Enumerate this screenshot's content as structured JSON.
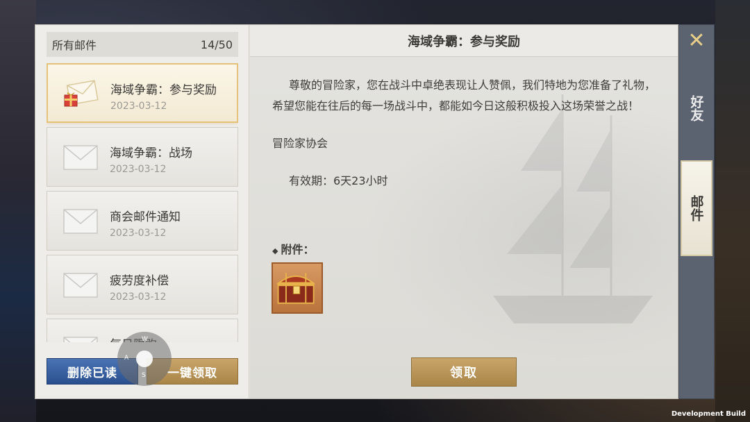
{
  "list": {
    "header_label": "所有邮件",
    "count": "14/50",
    "items": [
      {
        "title": "海域争霸：参与奖励",
        "date": "2023-03-12",
        "selected": true,
        "has_gift": true
      },
      {
        "title": "海域争霸：战场",
        "date": "2023-03-12",
        "selected": false,
        "has_gift": false
      },
      {
        "title": "商会邮件通知",
        "date": "2023-03-12",
        "selected": false,
        "has_gift": false
      },
      {
        "title": "疲劳度补偿",
        "date": "2023-03-12",
        "selected": false,
        "has_gift": false
      },
      {
        "title": "每日限购",
        "date": "",
        "selected": false,
        "has_gift": false
      }
    ],
    "delete_read_label": "删除已读",
    "claim_all_label": "一键领取"
  },
  "joystick": {
    "n": "W",
    "w": "A",
    "s": "S"
  },
  "detail": {
    "title": "海域争霸：参与奖励",
    "body": "尊敬的冒险家，您在战斗中卓绝表现让人赞佩，我们特地为您准备了礼物，希望您能在往后的每一场战斗中，都能如今日这般积极投入这场荣誉之战！",
    "sender": "冒险家协会",
    "validity": "有效期：6天23小时",
    "attachments_label": "附件：",
    "attachments": [
      {
        "icon": "treasure-chest-icon"
      }
    ],
    "claim_label": "领取"
  },
  "side_tabs": {
    "close_icon": "close-icon",
    "friends_label": "好友",
    "mail_label": "邮件",
    "active": "mail"
  },
  "overlay": {
    "dev_build": "Development Build"
  },
  "colors": {
    "accent_gold": "#c9a56a",
    "button_blue": "#2a4f8e",
    "selected_border": "#e4c27a",
    "tab_bar": "#5b6270"
  }
}
